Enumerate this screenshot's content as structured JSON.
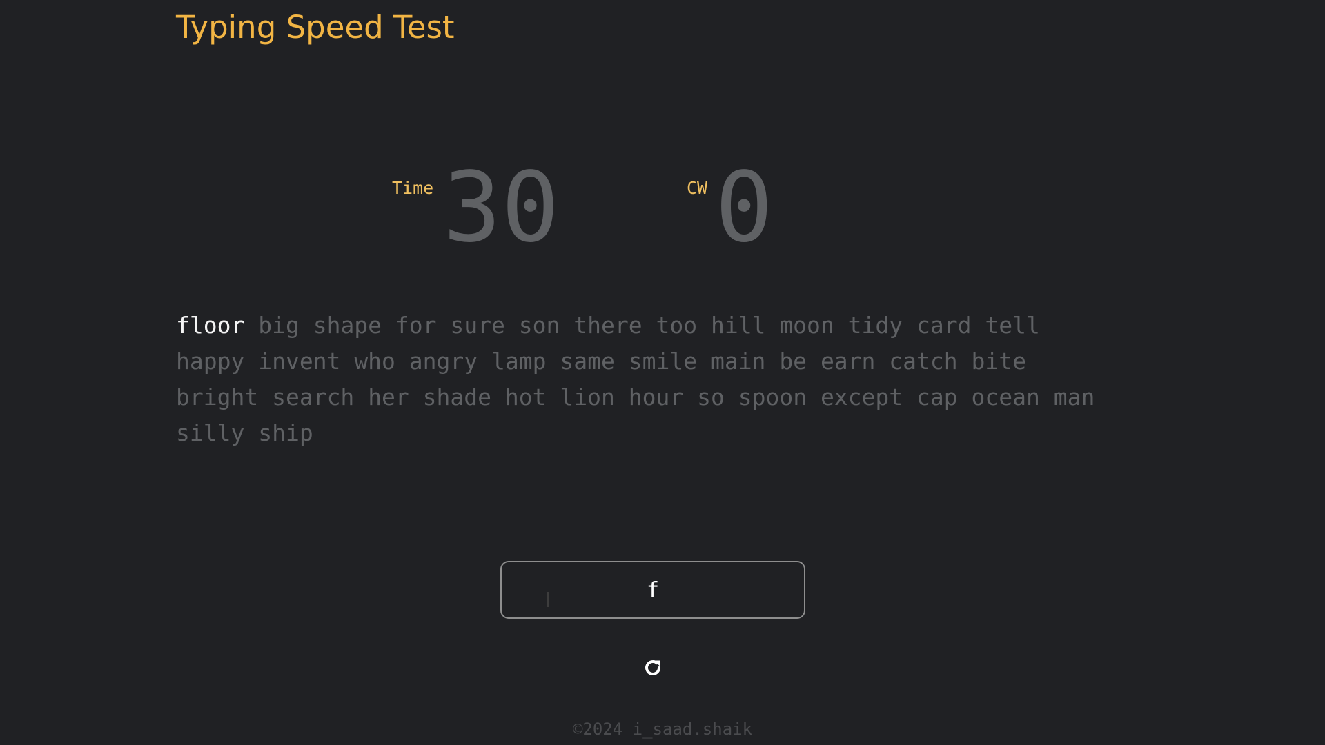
{
  "app": {
    "title": "Typing Speed Test"
  },
  "stats": {
    "time_label": "Time",
    "time_value": "30",
    "cw_label": "CW",
    "cw_value": "0"
  },
  "words": {
    "current": "floor",
    "remaining": [
      "big",
      "shape",
      "for",
      "sure",
      "son",
      "there",
      "too",
      "hill",
      "moon",
      "tidy",
      "card",
      "tell",
      "happy",
      "invent",
      "who",
      "angry",
      "lamp",
      "same",
      "smile",
      "main",
      "be",
      "earn",
      "catch",
      "bite",
      "bright",
      "search",
      "her",
      "shade",
      "hot",
      "lion",
      "hour",
      "so",
      "spoon",
      "except",
      "cap",
      "ocean",
      "man",
      "silly",
      "ship"
    ]
  },
  "input": {
    "value": "f"
  },
  "controls": {
    "refresh_icon": "refresh-icon"
  },
  "footer": {
    "text": "©2024 i_saad.shaik"
  },
  "colors": {
    "background": "#202124",
    "accent": "#f2b544",
    "muted": "#5f6164",
    "active_word": "#f4f4f4"
  }
}
